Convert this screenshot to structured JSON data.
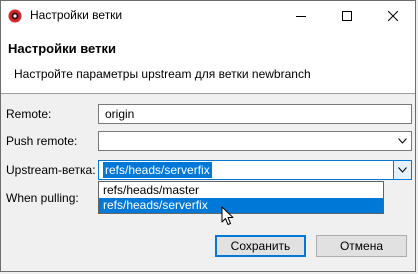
{
  "window": {
    "title": "Настройки ветки",
    "icon": "git-app-icon",
    "controls": [
      "minimize-icon",
      "maximize-icon",
      "close-icon"
    ]
  },
  "header": {
    "title": "Настройки ветки",
    "description": "Настройте параметры upstream для ветки newbranch"
  },
  "form": {
    "remote": {
      "label": "Remote:",
      "value": "origin"
    },
    "push_remote": {
      "label": "Push remote:",
      "value": ""
    },
    "upstream": {
      "label": "Upstream-ветка:",
      "value": "refs/heads/serverfix"
    },
    "when_pulling": {
      "label": "When pulling:"
    }
  },
  "dropdown": {
    "options": [
      "refs/heads/master",
      "refs/heads/serverfix"
    ],
    "selected_index": 1
  },
  "buttons": {
    "save": "Сохранить",
    "cancel": "Отмена"
  },
  "colors": {
    "accent": "#0078d7",
    "app_icon": "#d4262b"
  }
}
